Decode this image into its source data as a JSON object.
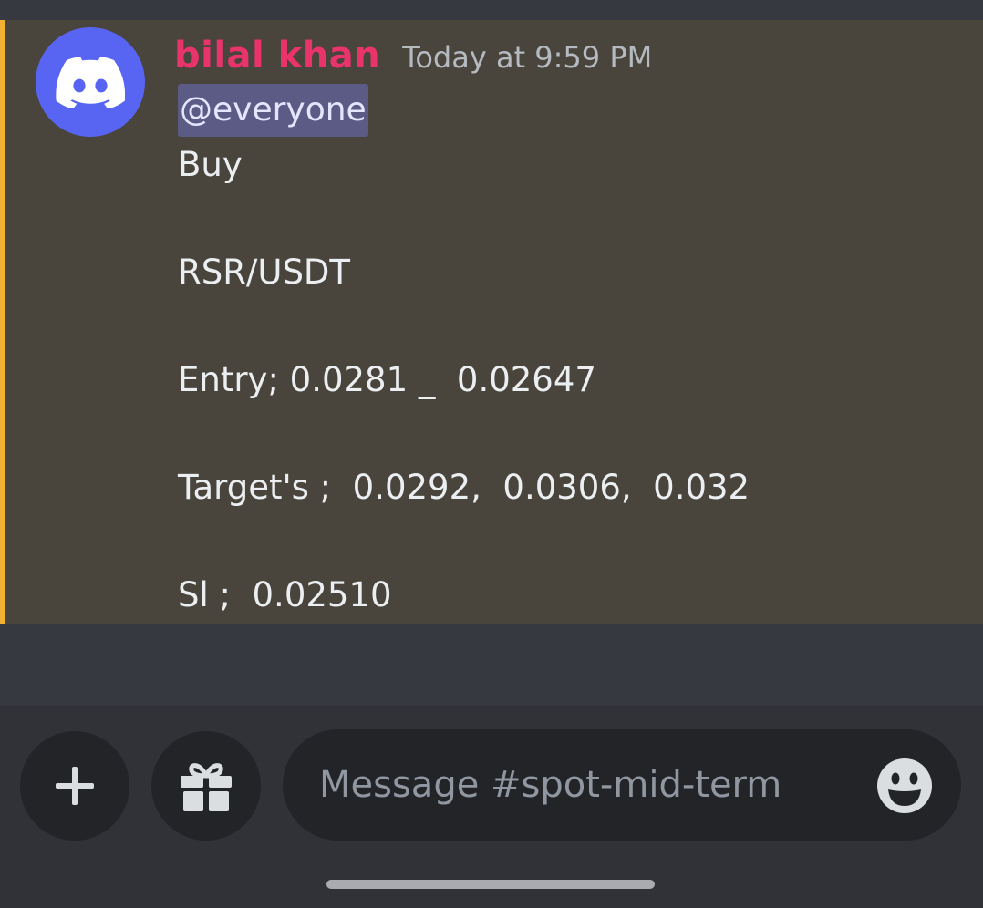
{
  "message": {
    "author": "bilal khan",
    "timestamp": "Today at 9:59 PM",
    "mention": "@everyone",
    "lines": [
      "Buy",
      "RSR/USDT",
      "Entry; 0.0281 _  0.02647",
      "Target's ;  0.0292,  0.0306,  0.032",
      "Sl ;  0.02510"
    ],
    "avatar_icon": "discord-logo-icon",
    "highlight_color": "#f0b132",
    "author_color": "#e8336b"
  },
  "composer": {
    "placeholder": "Message #spot-mid-term",
    "add_icon": "plus-icon",
    "gift_icon": "gift-icon",
    "emoji_icon": "emoji-icon"
  }
}
